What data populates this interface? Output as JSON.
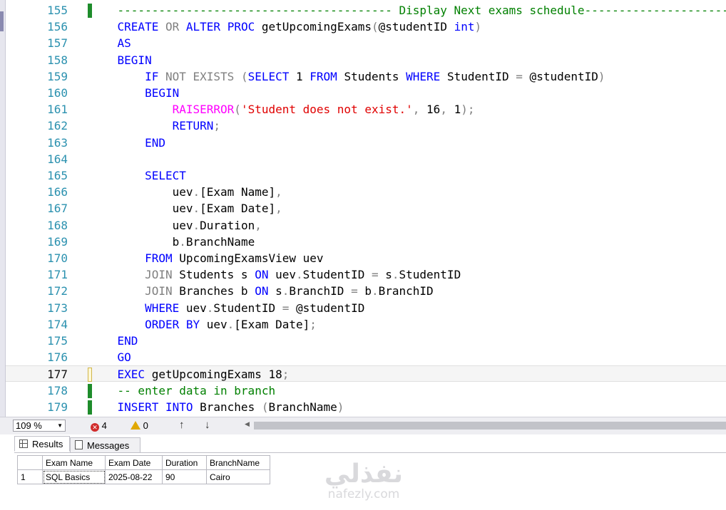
{
  "editor": {
    "lines": [
      {
        "n": "155",
        "marker": "saved",
        "tokens": [
          [
            "    ",
            ""
          ],
          [
            "---------------------------------------- Display Next exams schedule----------------------------------------",
            "cm"
          ]
        ]
      },
      {
        "n": "156",
        "marker": "none",
        "tokens": [
          [
            "    ",
            ""
          ],
          [
            "CREATE",
            "kw"
          ],
          [
            " ",
            ""
          ],
          [
            "OR",
            "gr"
          ],
          [
            " ",
            ""
          ],
          [
            "ALTER",
            "kw"
          ],
          [
            " ",
            ""
          ],
          [
            "PROC",
            "kw"
          ],
          [
            " getUpcomingExams",
            ""
          ],
          [
            "(",
            "pu"
          ],
          [
            "@studentID ",
            ""
          ],
          [
            "int",
            "kw"
          ],
          [
            ")",
            "pu"
          ]
        ]
      },
      {
        "n": "157",
        "marker": "none",
        "tokens": [
          [
            "    ",
            ""
          ],
          [
            "AS",
            "kw"
          ]
        ]
      },
      {
        "n": "158",
        "marker": "none",
        "tokens": [
          [
            "    ",
            ""
          ],
          [
            "BEGIN",
            "kw"
          ]
        ]
      },
      {
        "n": "159",
        "marker": "none",
        "tokens": [
          [
            "        ",
            ""
          ],
          [
            "IF",
            "kw"
          ],
          [
            " ",
            ""
          ],
          [
            "NOT EXISTS",
            "gr"
          ],
          [
            " ",
            ""
          ],
          [
            "(",
            "pu"
          ],
          [
            "SELECT",
            "kw"
          ],
          [
            " 1 ",
            ""
          ],
          [
            "FROM",
            "kw"
          ],
          [
            " Students ",
            ""
          ],
          [
            "WHERE",
            "kw"
          ],
          [
            " StudentID ",
            ""
          ],
          [
            "=",
            "pu"
          ],
          [
            " @studentID",
            ""
          ],
          [
            ")",
            "pu"
          ]
        ]
      },
      {
        "n": "160",
        "marker": "none",
        "tokens": [
          [
            "        ",
            ""
          ],
          [
            "BEGIN",
            "kw"
          ]
        ]
      },
      {
        "n": "161",
        "marker": "none",
        "tokens": [
          [
            "            ",
            ""
          ],
          [
            "RAISERROR",
            "fn"
          ],
          [
            "(",
            "pu"
          ],
          [
            "'Student does not exist.'",
            "str"
          ],
          [
            ",",
            "pu"
          ],
          [
            " 16",
            ""
          ],
          [
            ",",
            "pu"
          ],
          [
            " 1",
            ""
          ],
          [
            ");",
            "pu"
          ]
        ]
      },
      {
        "n": "162",
        "marker": "none",
        "tokens": [
          [
            "            ",
            ""
          ],
          [
            "RETURN",
            "kw"
          ],
          [
            ";",
            "pu"
          ]
        ]
      },
      {
        "n": "163",
        "marker": "none",
        "tokens": [
          [
            "        ",
            ""
          ],
          [
            "END",
            "kw"
          ]
        ]
      },
      {
        "n": "164",
        "marker": "none",
        "tokens": []
      },
      {
        "n": "165",
        "marker": "none",
        "tokens": [
          [
            "        ",
            ""
          ],
          [
            "SELECT",
            "kw"
          ]
        ]
      },
      {
        "n": "166",
        "marker": "none",
        "tokens": [
          [
            "            uev",
            ""
          ],
          [
            ".",
            "pu"
          ],
          [
            "[Exam Name]",
            ""
          ],
          [
            ",",
            "pu"
          ]
        ]
      },
      {
        "n": "167",
        "marker": "none",
        "tokens": [
          [
            "            uev",
            ""
          ],
          [
            ".",
            "pu"
          ],
          [
            "[Exam Date]",
            ""
          ],
          [
            ",",
            "pu"
          ]
        ]
      },
      {
        "n": "168",
        "marker": "none",
        "tokens": [
          [
            "            uev",
            ""
          ],
          [
            ".",
            "pu"
          ],
          [
            "Duration",
            ""
          ],
          [
            ",",
            "pu"
          ]
        ]
      },
      {
        "n": "169",
        "marker": "none",
        "tokens": [
          [
            "            b",
            ""
          ],
          [
            ".",
            "pu"
          ],
          [
            "BranchName",
            ""
          ]
        ]
      },
      {
        "n": "170",
        "marker": "none",
        "tokens": [
          [
            "        ",
            ""
          ],
          [
            "FROM",
            "kw"
          ],
          [
            " UpcomingExamsView uev",
            ""
          ]
        ]
      },
      {
        "n": "171",
        "marker": "none",
        "tokens": [
          [
            "        ",
            ""
          ],
          [
            "JOIN",
            "gr"
          ],
          [
            " Students s ",
            ""
          ],
          [
            "ON",
            "kw"
          ],
          [
            " uev",
            ""
          ],
          [
            ".",
            "pu"
          ],
          [
            "StudentID ",
            ""
          ],
          [
            "=",
            "pu"
          ],
          [
            " s",
            ""
          ],
          [
            ".",
            "pu"
          ],
          [
            "StudentID",
            ""
          ]
        ]
      },
      {
        "n": "172",
        "marker": "none",
        "tokens": [
          [
            "        ",
            ""
          ],
          [
            "JOIN",
            "gr"
          ],
          [
            " Branches b ",
            ""
          ],
          [
            "ON",
            "kw"
          ],
          [
            " s",
            ""
          ],
          [
            ".",
            "pu"
          ],
          [
            "BranchID ",
            ""
          ],
          [
            "=",
            "pu"
          ],
          [
            " b",
            ""
          ],
          [
            ".",
            "pu"
          ],
          [
            "BranchID",
            ""
          ]
        ]
      },
      {
        "n": "173",
        "marker": "none",
        "tokens": [
          [
            "        ",
            ""
          ],
          [
            "WHERE",
            "kw"
          ],
          [
            " uev",
            ""
          ],
          [
            ".",
            "pu"
          ],
          [
            "StudentID ",
            ""
          ],
          [
            "=",
            "pu"
          ],
          [
            " @studentID",
            ""
          ]
        ]
      },
      {
        "n": "174",
        "marker": "none",
        "tokens": [
          [
            "        ",
            ""
          ],
          [
            "ORDER BY",
            "kw"
          ],
          [
            " uev",
            ""
          ],
          [
            ".",
            "pu"
          ],
          [
            "[Exam Date]",
            ""
          ],
          [
            ";",
            "pu"
          ]
        ]
      },
      {
        "n": "175",
        "marker": "none",
        "tokens": [
          [
            "    ",
            ""
          ],
          [
            "END",
            "kw"
          ]
        ]
      },
      {
        "n": "176",
        "marker": "none",
        "tokens": [
          [
            "    ",
            ""
          ],
          [
            "GO",
            "kw"
          ]
        ]
      },
      {
        "n": "177",
        "marker": "unsaved",
        "current": true,
        "tokens": [
          [
            "    ",
            ""
          ],
          [
            "EXEC",
            "kw"
          ],
          [
            " getUpcomingExams 18",
            ""
          ],
          [
            ";",
            "pu"
          ]
        ]
      },
      {
        "n": "178",
        "marker": "saved",
        "tokens": [
          [
            "    ",
            ""
          ],
          [
            "-- enter data in branch",
            "cm"
          ]
        ]
      },
      {
        "n": "179",
        "marker": "saved",
        "tokens": [
          [
            "    ",
            ""
          ],
          [
            "INSERT",
            "kw"
          ],
          [
            " ",
            ""
          ],
          [
            "INTO",
            "kw"
          ],
          [
            " Branches ",
            ""
          ],
          [
            "(",
            "pu"
          ],
          [
            "BranchName",
            ""
          ],
          [
            ")",
            "pu"
          ]
        ]
      }
    ]
  },
  "status": {
    "zoom": "109 %",
    "errors": "4",
    "warnings": "0",
    "up_arrow": "↑",
    "down_arrow": "↓",
    "scroll_left": "◀"
  },
  "tabs": {
    "results_label": "Results",
    "messages_label": "Messages"
  },
  "results": {
    "columns": [
      "Exam Name",
      "Exam Date",
      "Duration",
      "BranchName"
    ],
    "rows": [
      {
        "rownum": "1",
        "cells": [
          "SQL Basics",
          "2025-08-22",
          "90",
          "Cairo"
        ]
      }
    ]
  },
  "watermark": {
    "arabic": "نفذلي",
    "latin": "nafezly.com"
  },
  "colors": {
    "keyword": "#0000ff",
    "comment": "#008000",
    "string": "#e00000",
    "function": "#ff00ff",
    "gray": "#808080",
    "line_number": "#2b91af",
    "change_bar": "#1e8c2b"
  }
}
